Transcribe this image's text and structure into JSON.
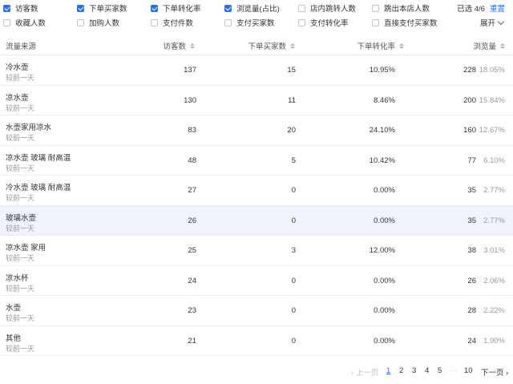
{
  "metrics": [
    {
      "label": "访客数",
      "checked": true
    },
    {
      "label": "下单买家数",
      "checked": true
    },
    {
      "label": "下单转化率",
      "checked": true
    },
    {
      "label": "浏览量(占比)",
      "checked": true
    },
    {
      "label": "店内跳转人数",
      "checked": false
    },
    {
      "label": "跳出本店人数",
      "checked": false
    },
    {
      "label": "收藏人数",
      "checked": false
    },
    {
      "label": "加购人数",
      "checked": false
    },
    {
      "label": "支付件数",
      "checked": false
    },
    {
      "label": "支付买家数",
      "checked": false
    },
    {
      "label": "支付转化率",
      "checked": false
    },
    {
      "label": "直接支付买家数",
      "checked": false
    }
  ],
  "selection": {
    "text": "已选 4/6",
    "reset": "重置"
  },
  "expand_label": "展开",
  "columns": {
    "source": "流量来源",
    "visitors": "访客数",
    "buyers": "下单买家数",
    "conversion": "下单转化率",
    "pageviews": "浏览量"
  },
  "rows": [
    {
      "source": "冷水壶",
      "compare": "较前一天",
      "visitors": "137",
      "buyers": "15",
      "conversion": "10.95%",
      "pageviews": "228",
      "share": "18.05%"
    },
    {
      "source": "凉水壶",
      "compare": "较前一天",
      "visitors": "130",
      "buyers": "11",
      "conversion": "8.46%",
      "pageviews": "200",
      "share": "15.84%"
    },
    {
      "source": "水壶家用凉水",
      "compare": "较前一天",
      "visitors": "83",
      "buyers": "20",
      "conversion": "24.10%",
      "pageviews": "160",
      "share": "12.67%"
    },
    {
      "source": "凉水壶 玻璃 耐高温",
      "compare": "较前一天",
      "visitors": "48",
      "buyers": "5",
      "conversion": "10.42%",
      "pageviews": "77",
      "share": "6.10%"
    },
    {
      "source": "冷水壶 玻璃 耐高温",
      "compare": "较前一天",
      "visitors": "27",
      "buyers": "0",
      "conversion": "0.00%",
      "pageviews": "35",
      "share": "2.77%"
    },
    {
      "source": "玻璃水壶",
      "compare": "较前一天",
      "visitors": "26",
      "buyers": "0",
      "conversion": "0.00%",
      "pageviews": "35",
      "share": "2.77%"
    },
    {
      "source": "凉水壶 家用",
      "compare": "较前一天",
      "visitors": "25",
      "buyers": "3",
      "conversion": "12.00%",
      "pageviews": "38",
      "share": "3.01%"
    },
    {
      "source": "凉水杯",
      "compare": "较前一天",
      "visitors": "24",
      "buyers": "0",
      "conversion": "0.00%",
      "pageviews": "26",
      "share": "2.06%"
    },
    {
      "source": "水壶",
      "compare": "较前一天",
      "visitors": "23",
      "buyers": "0",
      "conversion": "0.00%",
      "pageviews": "28",
      "share": "2.22%"
    },
    {
      "source": "其他",
      "compare": "较前一天",
      "visitors": "21",
      "buyers": "0",
      "conversion": "0.00%",
      "pageviews": "24",
      "share": "1.90%"
    }
  ],
  "pagination": {
    "prev": "上一页",
    "pages": [
      "1",
      "2",
      "3",
      "4",
      "5"
    ],
    "ellipsis": "···",
    "last": "10",
    "next": "下一页",
    "current": "1"
  },
  "colors": {
    "accent": "#2f6fe0",
    "highlight_row": "#eef3fc"
  }
}
